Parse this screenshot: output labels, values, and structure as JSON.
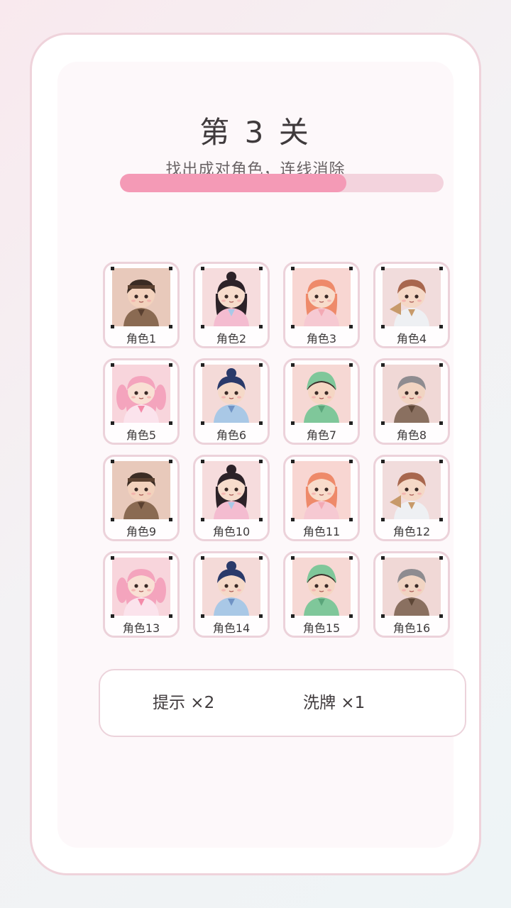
{
  "level": {
    "title": "第 3 关",
    "subtitle": "找出成对角色，连线消除"
  },
  "progress": {
    "fraction": 0.7
  },
  "tiles": [
    {
      "label": "角色1",
      "character": "boy-headband-brown"
    },
    {
      "label": "角色2",
      "character": "girl-hanfu-pink"
    },
    {
      "label": "角色3",
      "character": "girl-orange-hair"
    },
    {
      "label": "角色4",
      "character": "boy-fan-white"
    },
    {
      "label": "角色5",
      "character": "girl-pink-twintails"
    },
    {
      "label": "角色6",
      "character": "boy-blue-robe"
    },
    {
      "label": "角色7",
      "character": "boy-green-hood"
    },
    {
      "label": "角色8",
      "character": "boy-gray-hair-lute"
    },
    {
      "label": "角色9",
      "character": "boy-headband-brown"
    },
    {
      "label": "角色10",
      "character": "girl-hanfu-pink"
    },
    {
      "label": "角色11",
      "character": "girl-orange-hair"
    },
    {
      "label": "角色12",
      "character": "boy-fan-white"
    },
    {
      "label": "角色13",
      "character": "girl-pink-twintails"
    },
    {
      "label": "角色14",
      "character": "boy-blue-robe"
    },
    {
      "label": "角色15",
      "character": "boy-green-hood"
    },
    {
      "label": "角色16",
      "character": "boy-gray-hair-lute"
    }
  ],
  "tools": {
    "hint_label": "提示 ×2",
    "shuffle_label": "洗牌 ×1"
  },
  "colors": {
    "accent": "#f49ab6",
    "track": "#f3d3dd",
    "tile_border": "#ecd2da"
  }
}
